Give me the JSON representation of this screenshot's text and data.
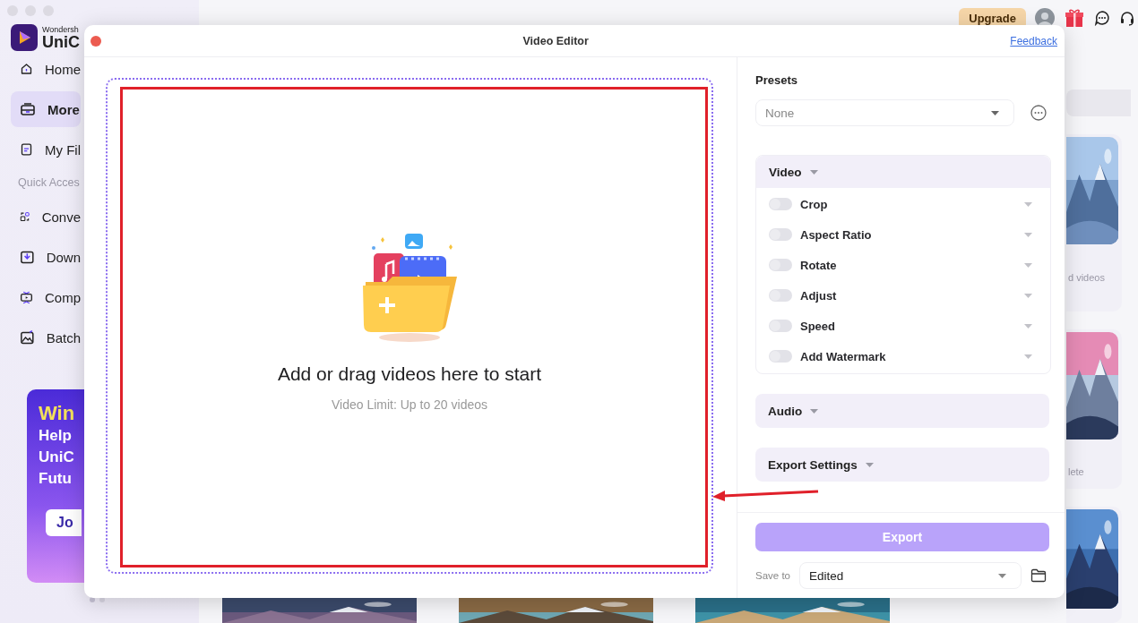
{
  "sidebar": {
    "brand": {
      "small": "Wondersh",
      "large": "UniC"
    },
    "nav_items": [
      {
        "label": "Home",
        "selected": false
      },
      {
        "label": "More",
        "selected": true
      },
      {
        "label": "My Fil",
        "selected": false
      }
    ],
    "section_label": "Quick Acces",
    "quick_items": [
      {
        "label": "Conve"
      },
      {
        "label": "Down"
      },
      {
        "label": "Comp"
      },
      {
        "label": "Batch"
      }
    ],
    "promo": {
      "title": "Win",
      "lines": [
        "Help",
        "UniC",
        "Futu"
      ],
      "button": "Jo"
    }
  },
  "top_bar": {
    "upgrade": "Upgrade"
  },
  "cards": [
    {
      "caption": "d videos"
    },
    {
      "caption": "lete"
    }
  ],
  "editor": {
    "title": "Video Editor",
    "feedback": "Feedback",
    "drop_zone": {
      "heading": "Add or drag videos here to start",
      "hint": "Video Limit: Up to 20 videos"
    },
    "presets": {
      "label": "Presets",
      "value": "None"
    },
    "sections": [
      {
        "title": "Video",
        "expanded": true,
        "options": [
          {
            "label": "Crop",
            "on": false
          },
          {
            "label": "Aspect Ratio",
            "on": false
          },
          {
            "label": "Rotate",
            "on": false
          },
          {
            "label": "Adjust",
            "on": false
          },
          {
            "label": "Speed",
            "on": false
          },
          {
            "label": "Add Watermark",
            "on": false
          }
        ]
      },
      {
        "title": "Audio",
        "expanded": false
      },
      {
        "title": "Export Settings",
        "expanded": false
      }
    ],
    "export_button": {
      "label": "Export",
      "disabled": true
    },
    "save_to": {
      "label": "Save to",
      "value": "Edited"
    }
  }
}
